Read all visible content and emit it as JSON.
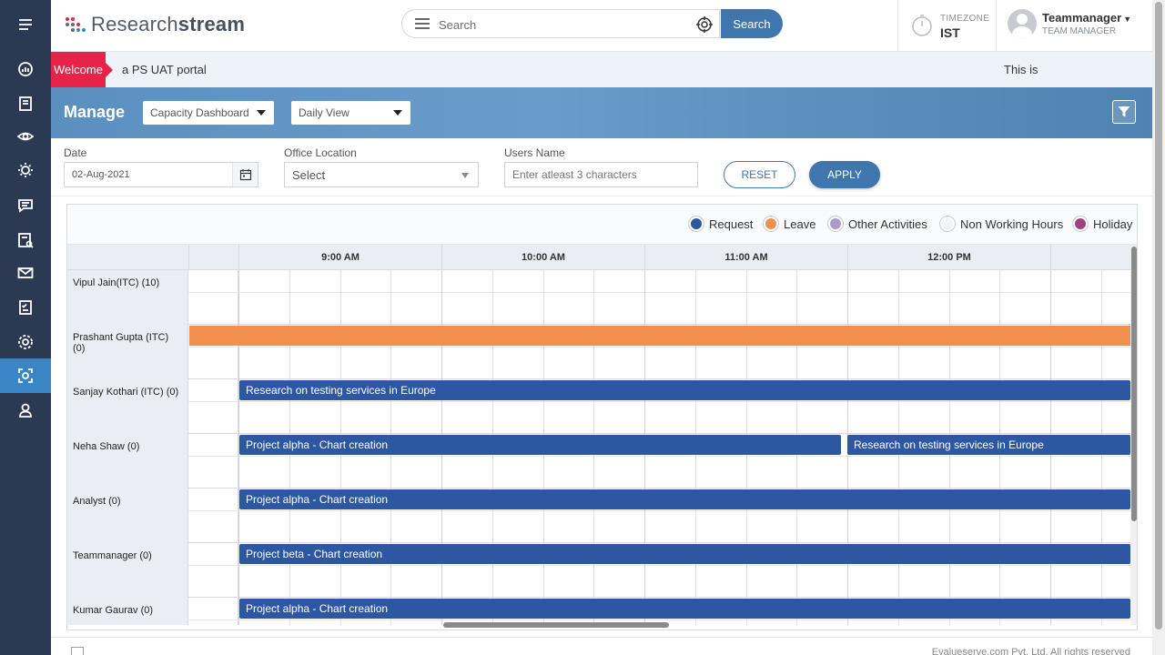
{
  "app": {
    "logo_light": "Research",
    "logo_bold": "stream"
  },
  "search": {
    "placeholder": "Search",
    "button_label": "Search"
  },
  "timezone": {
    "label": "TIMEZONE",
    "value": "IST"
  },
  "user": {
    "name": "Teammanager",
    "role": "TEAM MANAGER"
  },
  "welcome": {
    "tag": "Welcome",
    "message": "a PS UAT portal",
    "right_text": "This is"
  },
  "banner": {
    "title": "Manage",
    "dashboard_select": "Capacity Dashboard",
    "view_select": "Daily View"
  },
  "filters": {
    "date_label": "Date",
    "date_value": "02-Aug-2021",
    "office_label": "Office Location",
    "office_value": "Select",
    "users_label": "Users Name",
    "users_placeholder": "Enter atleast 3 characters",
    "reset_label": "RESET",
    "apply_label": "APPLY"
  },
  "legend": [
    {
      "label": "Request",
      "color": "#2d57a1"
    },
    {
      "label": "Leave",
      "color": "#f1904d"
    },
    {
      "label": "Other Activities",
      "color": "#a99bc8"
    },
    {
      "label": "Non Working Hours",
      "color": "#f4f4f4"
    },
    {
      "label": "Holiday",
      "color": "#a0417f"
    }
  ],
  "schedule": {
    "hours": [
      "9:00 AM",
      "10:00 AM",
      "11:00 AM",
      "12:00 PM"
    ],
    "rows": [
      {
        "name": "Vipul Jain(ITC) (10)",
        "bars": []
      },
      {
        "name": "Prashant Gupta (ITC) (0)",
        "bars": [
          {
            "type": "leave",
            "label": "",
            "start": "8:00 AM",
            "end": "1:00 PM+"
          }
        ]
      },
      {
        "name": "Sanjay Kothari (ITC) (0)",
        "bars": [
          {
            "type": "request",
            "label": "Research on testing services in Europe",
            "start": "8:15 AM",
            "end": "1:00 PM+"
          }
        ]
      },
      {
        "name": "Neha Shaw (0)",
        "bars": [
          {
            "type": "request",
            "label": "Project alpha - Chart creation",
            "start": "8:15 AM",
            "end": "11:15 AM"
          },
          {
            "type": "request",
            "label": "Research on testing services in Europe",
            "start": "11:15 AM",
            "end": "1:00 PM+"
          }
        ]
      },
      {
        "name": "Analyst (0)",
        "bars": [
          {
            "type": "request",
            "label": "Project alpha - Chart creation",
            "start": "8:15 AM",
            "end": "1:00 PM+"
          }
        ]
      },
      {
        "name": "Teammanager (0)",
        "bars": [
          {
            "type": "request",
            "label": "Project beta - Chart creation",
            "start": "8:15 AM",
            "end": "1:00 PM+"
          }
        ]
      },
      {
        "name": "Kumar Gaurav (0)",
        "bars": [
          {
            "type": "request",
            "label": "Project alpha - Chart creation",
            "start": "8:15 AM",
            "end": "1:00 PM+"
          }
        ]
      }
    ]
  },
  "footer": {
    "text": "Evalueserve.com Pvt. Ltd. All rights reserved"
  },
  "sidebar": {
    "items": [
      {
        "icon": "menu-icon"
      },
      {
        "icon": "dashboard-gauge-icon"
      },
      {
        "icon": "notes-icon"
      },
      {
        "icon": "eye-icon"
      },
      {
        "icon": "bulb-icon"
      },
      {
        "icon": "chat-icon"
      },
      {
        "icon": "report-search-icon"
      },
      {
        "icon": "mail-icon"
      },
      {
        "icon": "checklist-icon"
      },
      {
        "icon": "settings-icon"
      },
      {
        "icon": "capacity-icon",
        "active": true
      },
      {
        "icon": "user-icon"
      }
    ]
  }
}
